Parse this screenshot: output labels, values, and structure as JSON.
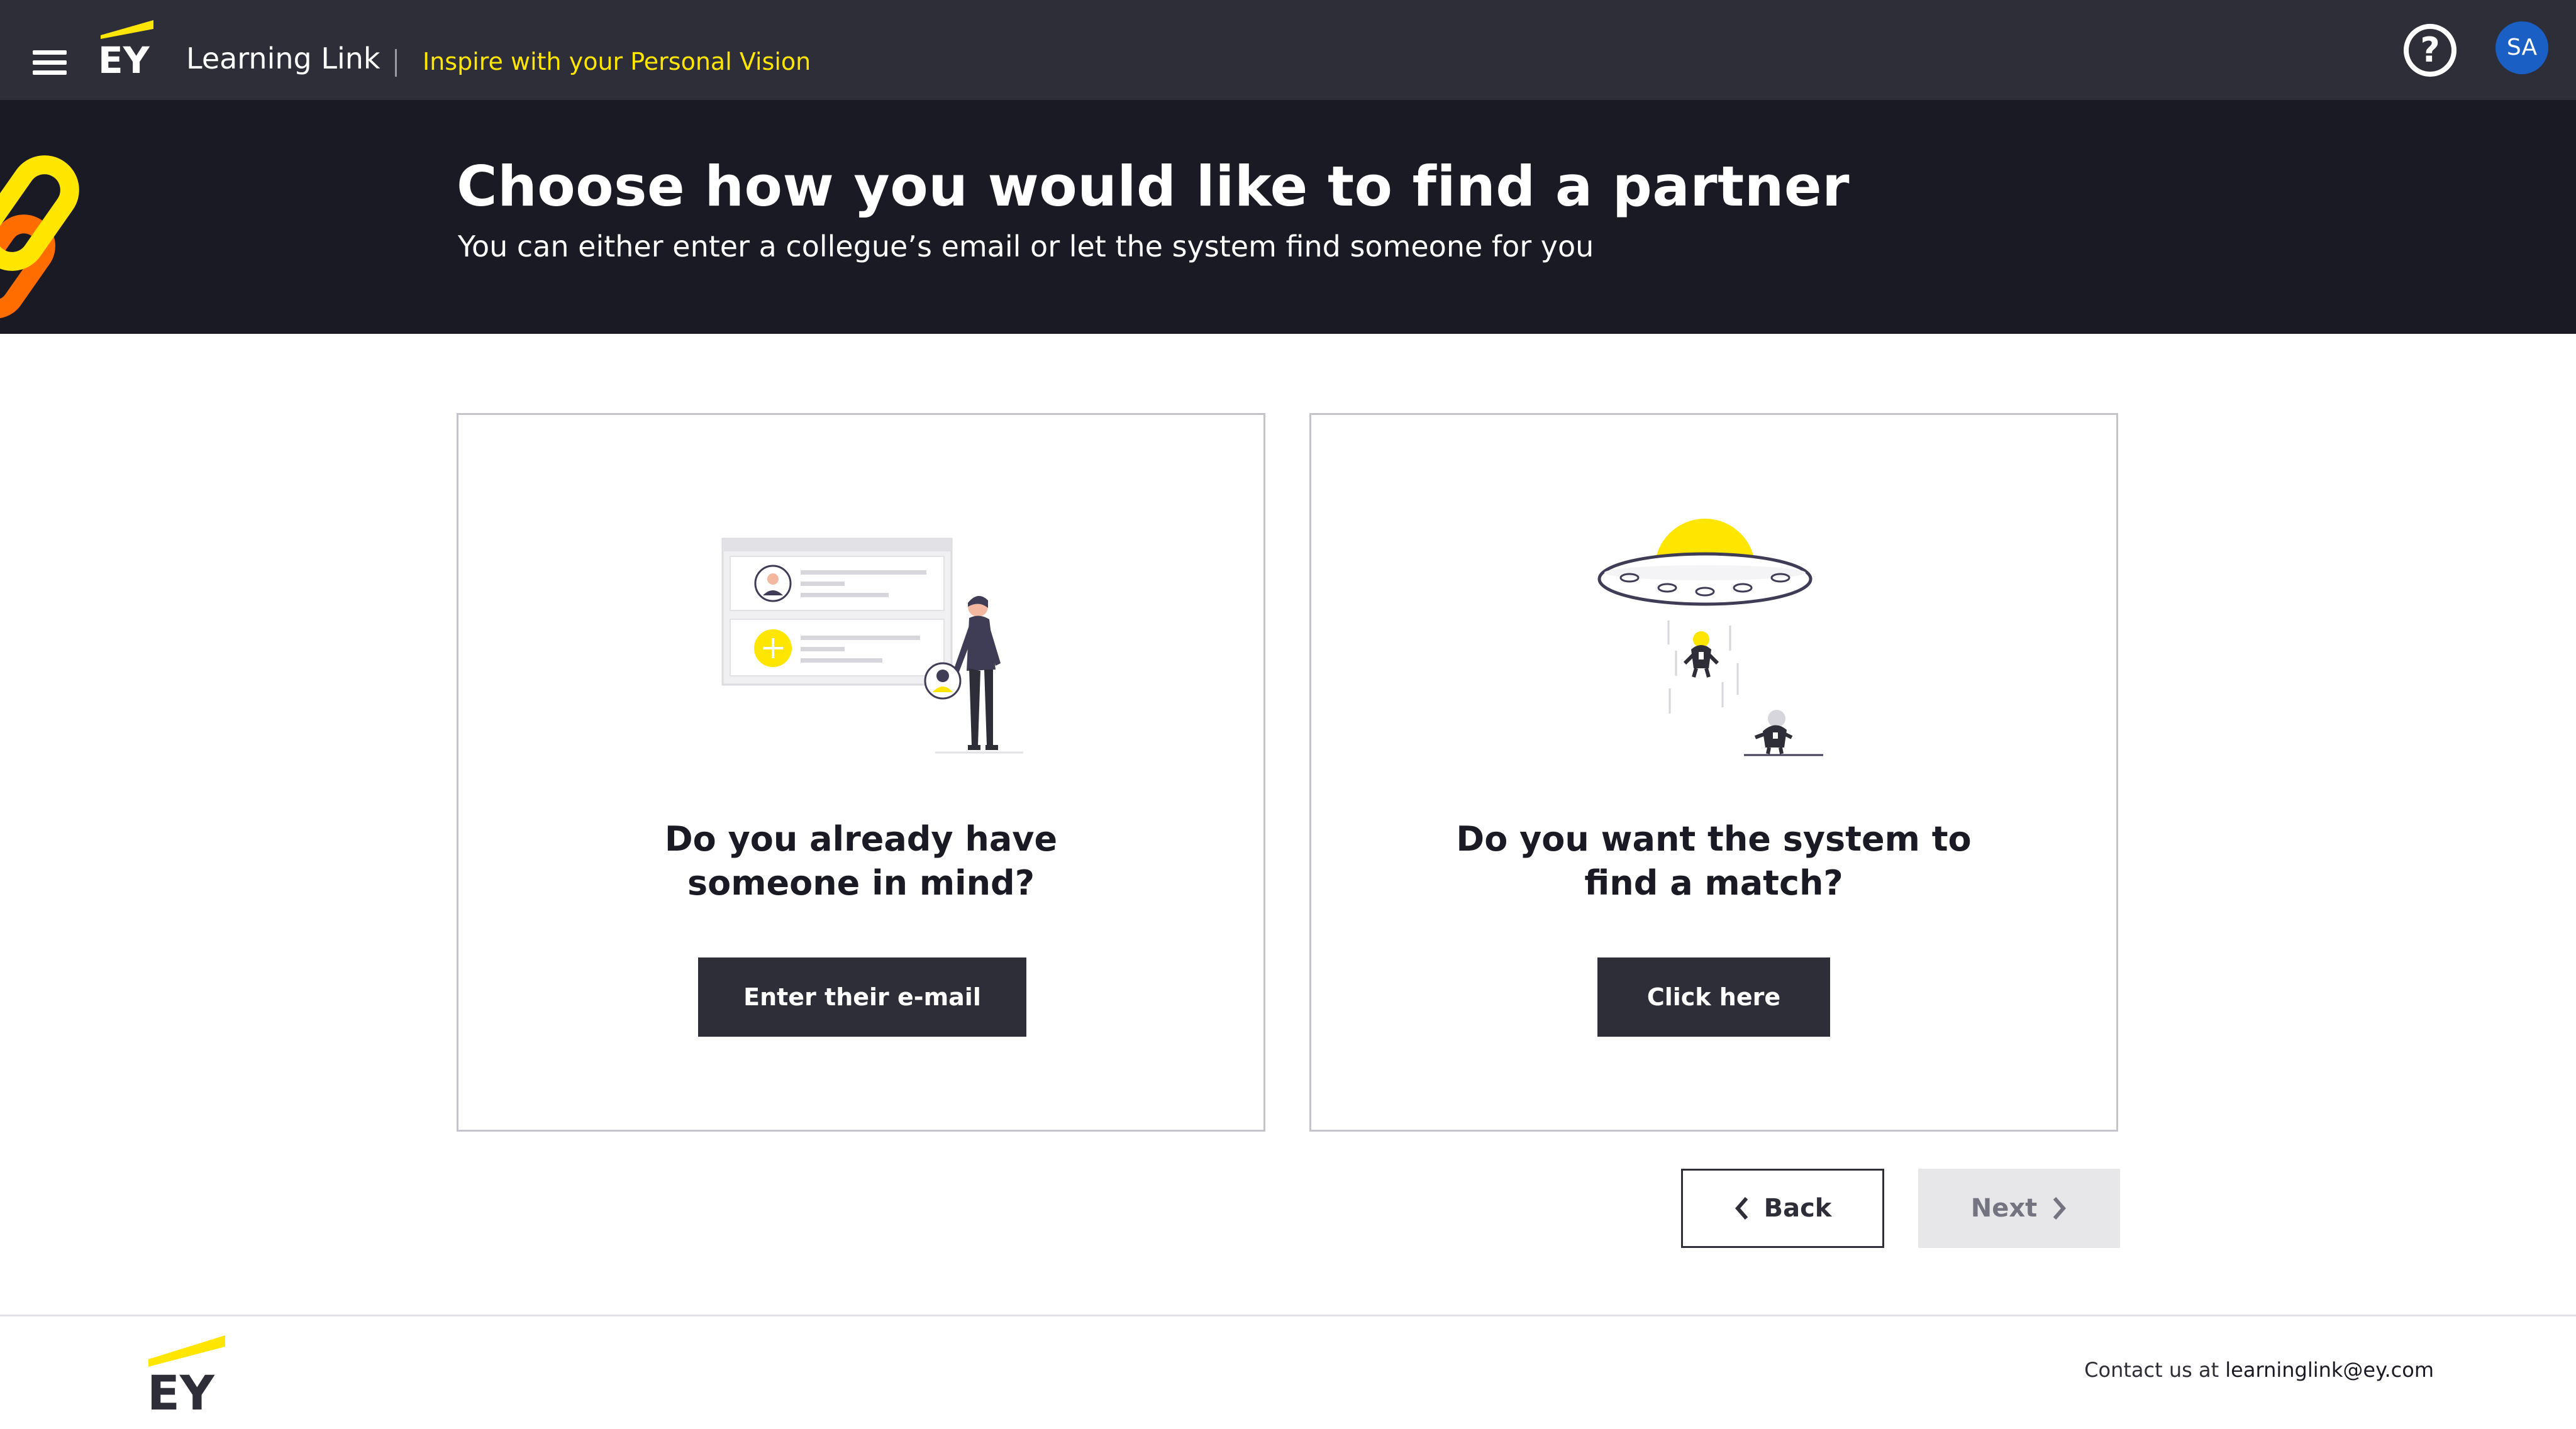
{
  "nav": {
    "brand": "EY",
    "app_title": "Learning Link",
    "separator": "|",
    "tagline": "Inspire with your Personal Vision",
    "help_symbol": "?",
    "user_initials": "SA",
    "icons": {
      "menu": "hamburger-icon",
      "help": "question-circle-icon"
    }
  },
  "hero": {
    "title": "Choose how you would like to find a partner",
    "subtitle": "You can either enter a collegue’s email or let the system find someone for you"
  },
  "options": [
    {
      "question_line1": "Do you already have",
      "question_line2": "someone in mind?",
      "button_label": "Enter their e-mail",
      "illustration": "profile-list-illustration"
    },
    {
      "question_line1": "Do you want the system to",
      "question_line2": "find a match?",
      "button_label": "Click here",
      "illustration": "ufo-abduction-illustration"
    }
  ],
  "navigation": {
    "back_label": "Back",
    "next_label": "Next",
    "next_enabled": false
  },
  "footer": {
    "brand": "EY",
    "contact_prefix": "Contact us at ",
    "contact_email": "learninglink@ey.com"
  },
  "colors": {
    "nav_bg": "#2e2e38",
    "hero_bg": "#1a1a24",
    "accent_yellow": "#ffe600",
    "accent_orange": "#ff6d00",
    "avatar_blue": "#1a5fc4",
    "button_dark": "#2e2e38",
    "button_disabled": "#e7e7ea"
  }
}
